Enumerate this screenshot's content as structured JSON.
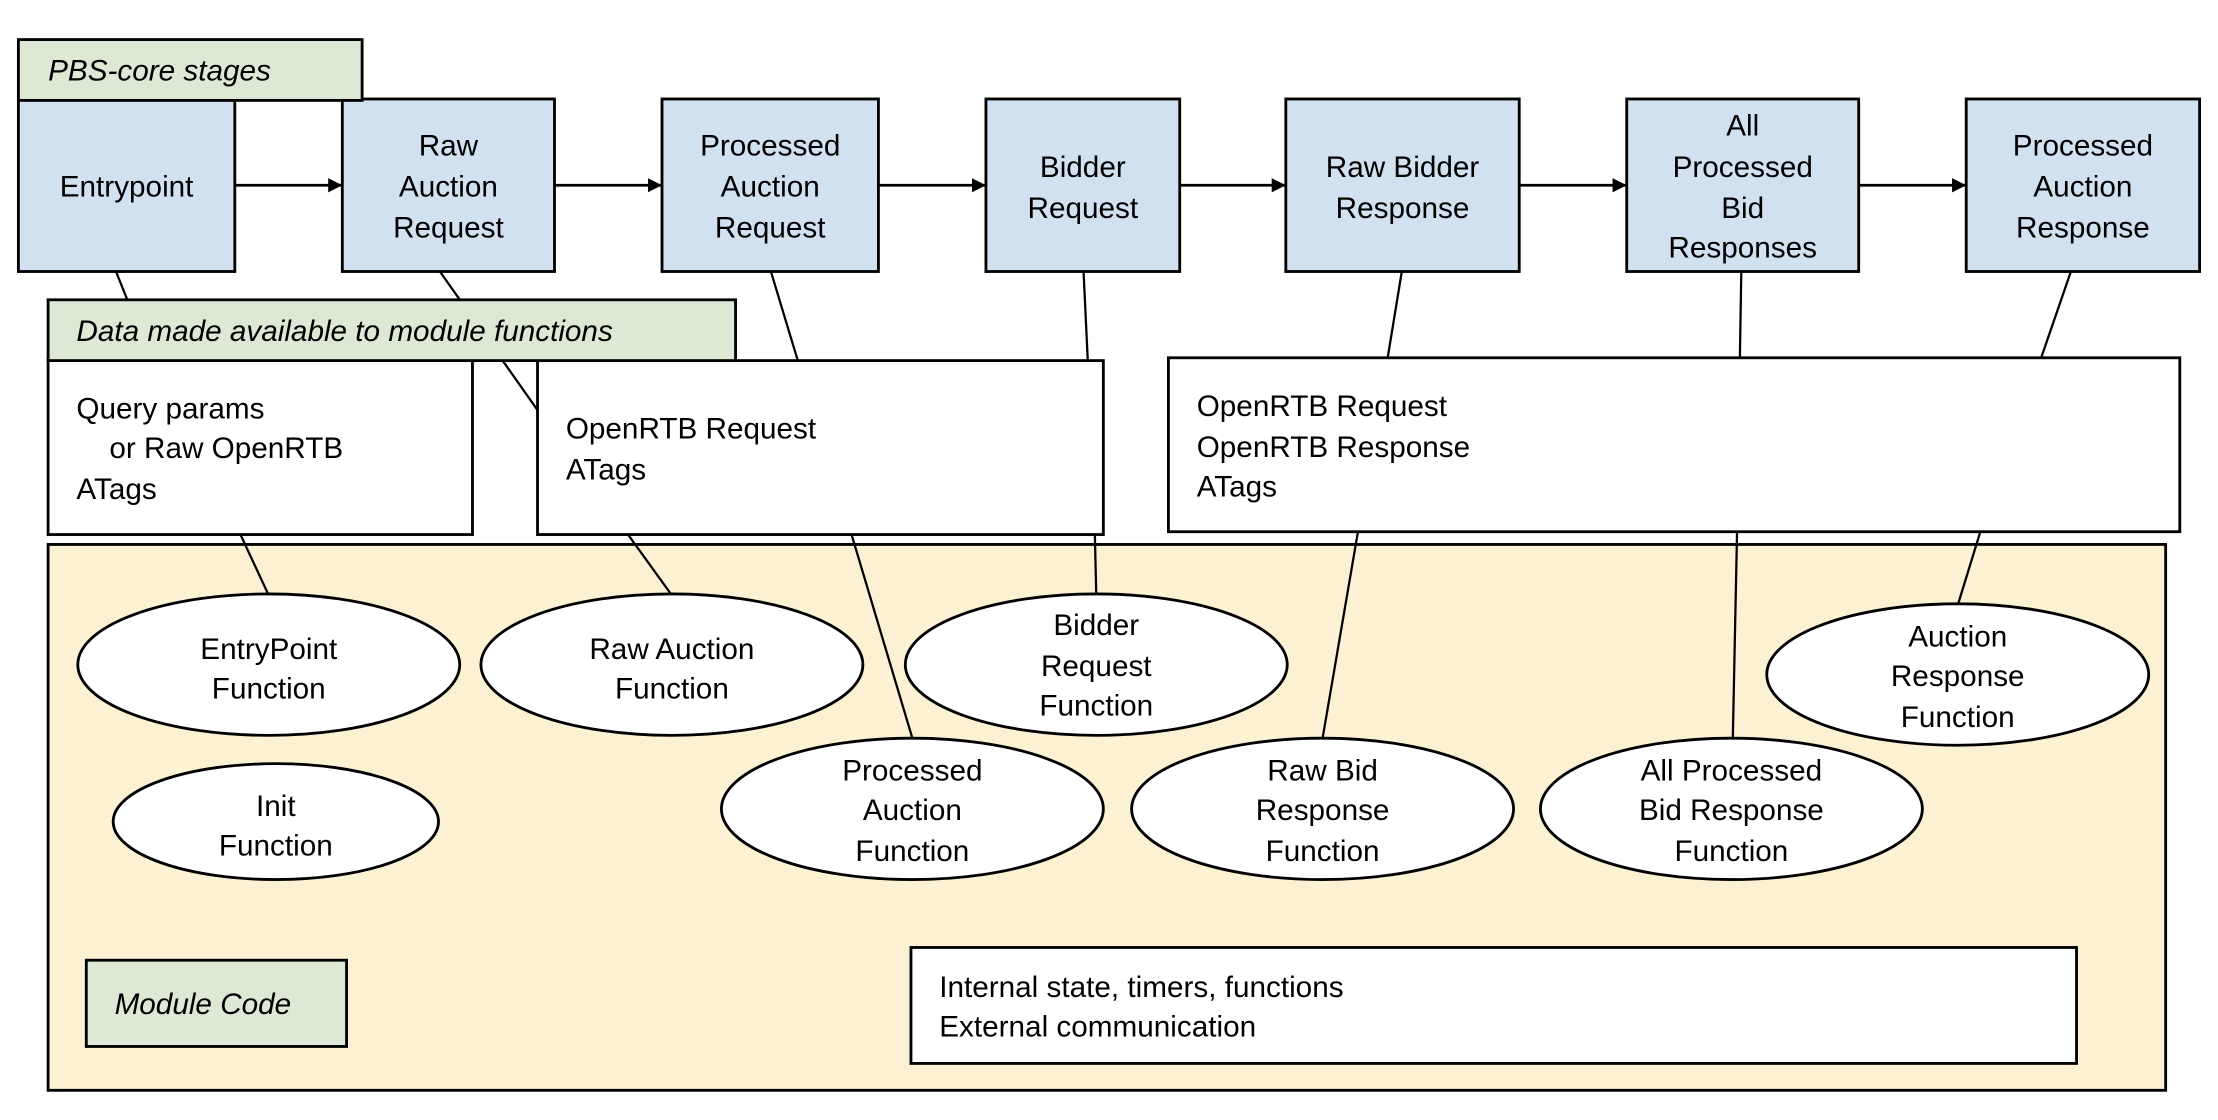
{
  "labels": {
    "pbs_core_stages": "PBS-core stages",
    "data_available": "Data made available to module functions",
    "module_code": "Module Code"
  },
  "stages": [
    {
      "id": "entrypoint",
      "lines": [
        "Entrypoint"
      ]
    },
    {
      "id": "raw-auction-request",
      "lines": [
        "Raw",
        "Auction",
        "Request"
      ]
    },
    {
      "id": "processed-auction-request",
      "lines": [
        "Processed",
        "Auction",
        "Request"
      ]
    },
    {
      "id": "bidder-request",
      "lines": [
        "Bidder",
        "Request"
      ]
    },
    {
      "id": "raw-bidder-response",
      "lines": [
        "Raw Bidder",
        "Response"
      ]
    },
    {
      "id": "all-processed-bid-responses",
      "lines": [
        "All",
        "Processed",
        "Bid",
        "Responses"
      ]
    },
    {
      "id": "processed-auction-response",
      "lines": [
        "Processed",
        "Auction",
        "Response"
      ]
    }
  ],
  "data_boxes": [
    {
      "id": "entrypoint-data",
      "lines": [
        "Query params",
        "    or Raw OpenRTB",
        "ATags"
      ]
    },
    {
      "id": "request-data",
      "lines": [
        "OpenRTB Request",
        "ATags"
      ]
    },
    {
      "id": "response-data",
      "lines": [
        "OpenRTB Request",
        "OpenRTB Response",
        "ATags"
      ]
    }
  ],
  "functions": [
    {
      "id": "entrypoint-function",
      "lines": [
        "EntryPoint",
        "Function"
      ]
    },
    {
      "id": "raw-auction-function",
      "lines": [
        "Raw Auction",
        "Function"
      ]
    },
    {
      "id": "bidder-request-function",
      "lines": [
        "Bidder",
        "Request",
        "Function"
      ]
    },
    {
      "id": "auction-response-function",
      "lines": [
        "Auction",
        "Response",
        "Function"
      ]
    },
    {
      "id": "init-function",
      "lines": [
        "Init",
        "Function"
      ]
    },
    {
      "id": "processed-auction-function",
      "lines": [
        "Processed",
        "Auction",
        "Function"
      ]
    },
    {
      "id": "raw-bid-response-function",
      "lines": [
        "Raw Bid",
        "Response",
        "Function"
      ]
    },
    {
      "id": "all-processed-bid-response-function",
      "lines": [
        "All Processed",
        "Bid Response",
        "Function"
      ]
    }
  ],
  "module_internals": {
    "lines": [
      "Internal state, timers, functions",
      "External communication"
    ]
  },
  "colors": {
    "stage_fill": "#d1e1f0",
    "label_fill": "#dde8d5",
    "module_fill": "#fcf1d3"
  }
}
